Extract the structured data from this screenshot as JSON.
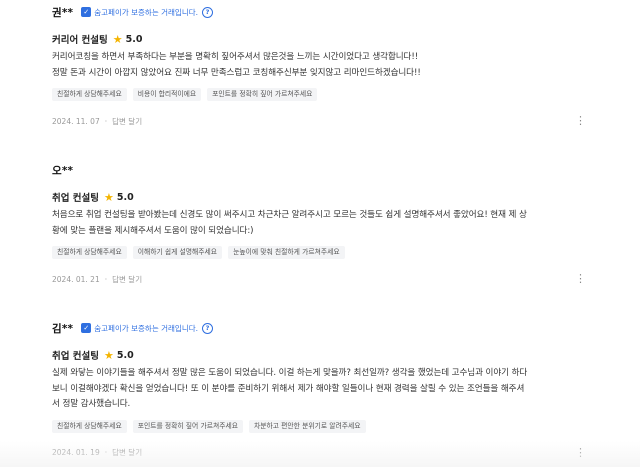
{
  "reviews": [
    {
      "author": "권**",
      "verified": true,
      "badge_text": "숨고페이가 보증하는 거래입니다.",
      "service": "커리어 컨설팅",
      "rating": "5.0",
      "lines": [
        "커리어코칭을 하면서 부족하다는 부분을 명확히 짚어주셔서 많은것을 느끼는 시간이었다고 생각합니다!!",
        "정말 돈과 시간이 아깝지 않았어요 진짜 너무 만족스럽고 코칭해주신부분 잊지않고 리마인드하겠습니다!!"
      ],
      "tags": [
        "친절하게 상담해주세요",
        "비용이 합리적이에요",
        "포인트를 정확히 짚어 가르쳐주세요"
      ],
      "date": "2024. 11. 07",
      "reply": "답변 달기"
    },
    {
      "author": "오**",
      "verified": false,
      "badge_text": "",
      "service": "취업 컨설팅",
      "rating": "5.0",
      "lines": [
        "처음으로 취업 컨설팅을 받아봤는데 신경도 많이 써주시고 차근차근 알려주시고 모르는 것들도 쉽게 설명해주셔서 좋았어요! 현재 제 상",
        "황에 맞는 플랜을 제시해주셔서 도움이 많이 되었습니다:)"
      ],
      "tags": [
        "친절하게 상담해주세요",
        "이해하기 쉽게 설명해주세요",
        "눈높이에 맞춰 친절하게 가르쳐주세요"
      ],
      "date": "2024. 01. 21",
      "reply": "답변 달기"
    },
    {
      "author": "김**",
      "verified": true,
      "badge_text": "숨고페이가 보증하는 거래입니다.",
      "service": "취업 컨설팅",
      "rating": "5.0",
      "lines": [
        "실제 와닿는 이야기들을 해주셔서 정말 많은 도움이 되었습니다. 이걸 하는게 맞을까? 최선일까? 생각을 했었는데 고수님과 이야기 하다",
        "보니 이걸해야겠다 확신을 얻었습니다! 또 이 분야를 준비하기 위해서 제가 해야할 일들이나 현재 경력을 살릴 수 있는 조언들을 해주셔",
        "서 정말 감사했습니다."
      ],
      "tags": [
        "친절하게 상담해주세요",
        "포인트를 정확히 짚어 가르쳐주세요",
        "차분하고 편안한 분위기로 알려주세요"
      ],
      "date": "2024. 01. 19",
      "reply": "답변 달기"
    }
  ],
  "colors": {
    "accent": "#2f6fe0",
    "star": "#f4b400",
    "tag_bg": "#f3f4f6",
    "meta": "#999999"
  },
  "icons": {
    "badge": "shield-check-icon",
    "info": "info-icon",
    "star": "star-icon",
    "more": "kebab-menu-icon"
  }
}
